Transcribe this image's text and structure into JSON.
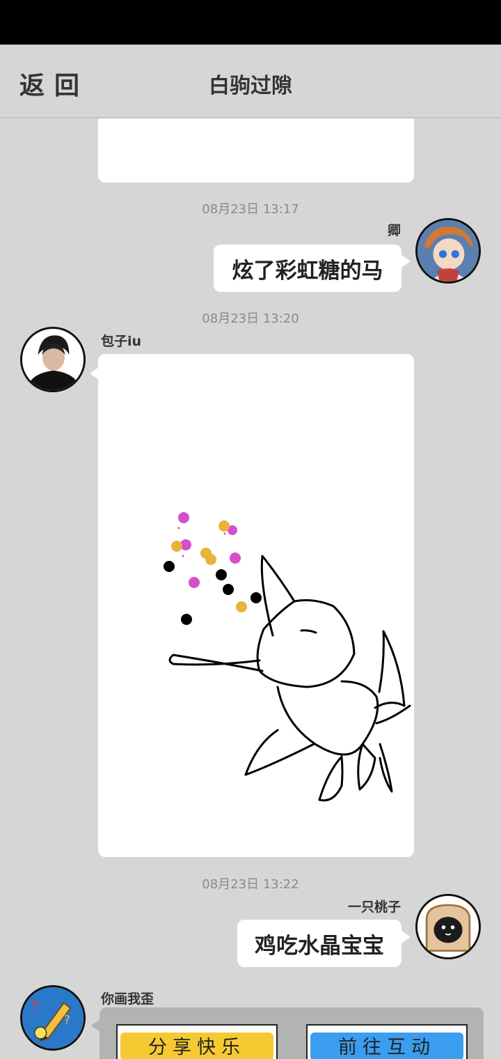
{
  "header": {
    "back_label": "返回",
    "title": "白驹过隙"
  },
  "messages": [
    {
      "timestamp": "08月23日 13:17",
      "sender": "卿",
      "text": "炫了彩虹糖的马"
    },
    {
      "timestamp": "08月23日 13:20",
      "sender": "包子iu",
      "content": "drawing"
    },
    {
      "timestamp": "08月23日 13:22",
      "sender": "一只桃子",
      "text": "鸡吃水晶宝宝"
    },
    {
      "sender": "你画我歪",
      "buttons": [
        "分享快乐",
        "前往互动"
      ]
    }
  ],
  "colors": {
    "background": "#d6d6d6",
    "bubble": "#ffffff",
    "dot_magenta": "#d44fc8",
    "dot_yellow": "#e8b33a",
    "share_paint": "#f6c933",
    "go_paint": "#3a9df0"
  }
}
